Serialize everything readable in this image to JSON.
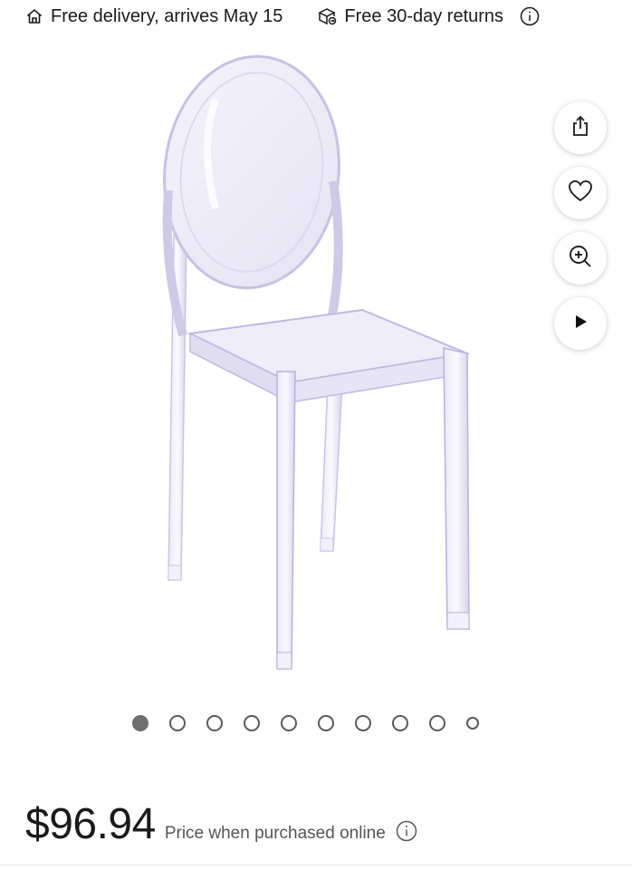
{
  "delivery": {
    "free_delivery_text": "Free delivery, arrives May 15",
    "returns_text": "Free 30-day returns",
    "icons": [
      "home-icon",
      "returns-box-icon",
      "info-icon"
    ]
  },
  "gallery": {
    "image_alt": "Clear acrylic Victorian style armless side chair",
    "actions": [
      "share-icon",
      "heart-icon",
      "zoom-in-icon",
      "play-icon"
    ],
    "dot_count": 10,
    "active_dot": 1
  },
  "price": {
    "amount": "$96.94",
    "note": "Price when purchased online"
  },
  "colors": {
    "text": "#1a1a1a",
    "muted": "#555555",
    "dot_active": "#6e6e6e"
  }
}
